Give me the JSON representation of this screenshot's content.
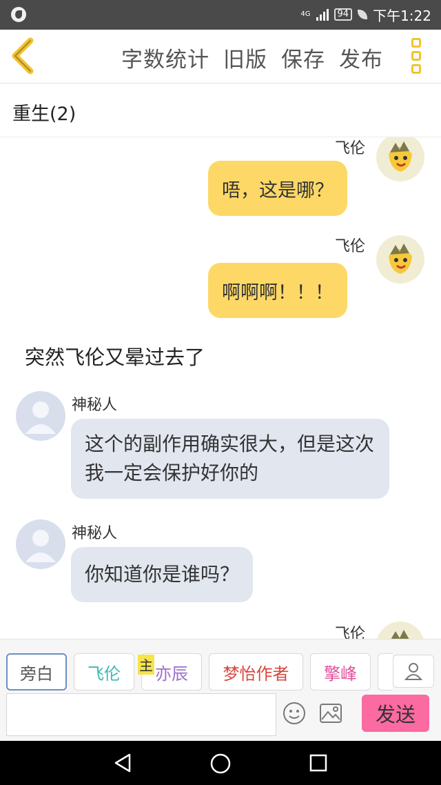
{
  "status_bar": {
    "network": "4G",
    "battery": "94",
    "time": "下午1:22"
  },
  "header": {
    "actions": [
      "字数统计",
      "旧版",
      "保存",
      "发布"
    ]
  },
  "chapter": {
    "title": "重生(2)"
  },
  "messages": [
    {
      "side": "right",
      "speaker": "飞伦",
      "text": ""
    },
    {
      "side": "right",
      "speaker": "",
      "text": "唔，这是哪？"
    },
    {
      "side": "right",
      "speaker": "飞伦",
      "text": "啊啊啊！！！"
    },
    {
      "side": "narration",
      "speaker": "",
      "text": "突然飞伦又晕过去了"
    },
    {
      "side": "left",
      "speaker": "神秘人",
      "text": "这个的副作用确实很大，但是这次我一定会保护好你的"
    },
    {
      "side": "left",
      "speaker": "神秘人",
      "text": "你知道你是谁吗？"
    },
    {
      "side": "right",
      "speaker": "飞伦",
      "text": ""
    }
  ],
  "roles": [
    {
      "label": "旁白",
      "color": "#555555"
    },
    {
      "label": "飞伦",
      "color": "#3bb8b0"
    },
    {
      "label": "亦辰",
      "color": "#9b6fc9"
    },
    {
      "label": "梦怡作者",
      "color": "#d9463e"
    },
    {
      "label": "擎峰",
      "color": "#e0519b"
    }
  ],
  "role_badge": "主",
  "composer": {
    "placeholder": "",
    "send_label": "发送"
  },
  "colors": {
    "accent": "#f2c230",
    "self_bubble": "#fdd866",
    "other_bubble": "#e1e6ef",
    "send_button": "#fb6aa1"
  },
  "icons": [
    "back-arrow-icon",
    "more-vertical-icon",
    "person-add-icon",
    "emoji-icon",
    "image-icon",
    "nav-back-icon",
    "nav-home-icon",
    "nav-recent-icon"
  ]
}
